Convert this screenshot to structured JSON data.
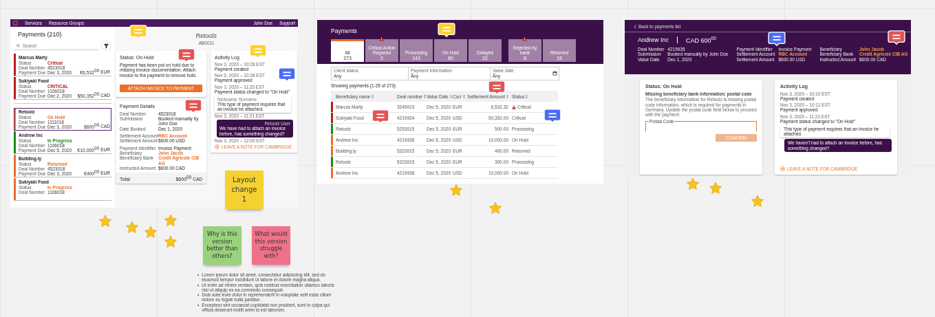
{
  "frame_list_view": {
    "top_bar": {
      "menus": [
        {
          "label": "Services"
        },
        {
          "label": "Resource Groups"
        }
      ],
      "user_menus": [
        {
          "label": "John Doe"
        },
        {
          "label": "Support"
        }
      ]
    },
    "list": {
      "title": "Payments (210)",
      "search_placeholder": "Search",
      "items": [
        {
          "name": "Marcus Marty",
          "color": "#b71c1c",
          "selected": false,
          "rows": [
            {
              "label": "Status",
              "value": "Critical"
            },
            {
              "label": "Deal Number",
              "value": "4523018"
            },
            {
              "label": "Payment Due",
              "value": "Dec 3, 2020"
            }
          ],
          "amount": "€6,532",
          "decimals": "00",
          "currency": "EUR"
        },
        {
          "name": "Sukiyaki Food",
          "color": "#b71c1c",
          "selected": false,
          "rows": [
            {
              "label": "Status",
              "value": "CRITICAL"
            },
            {
              "label": "Deal Number",
              "value": "1106018"
            },
            {
              "label": "Payment Due",
              "value": "Dec 2, 2020"
            }
          ],
          "amount": "$50,352",
          "decimals": "00",
          "currency": "CAD"
        },
        {
          "name": "Retoolz",
          "color": "#e8702a",
          "selected": true,
          "rows": [
            {
              "label": "Status",
              "value": "On Hold"
            },
            {
              "label": "Deal Number",
              "value": "1111018"
            },
            {
              "label": "Payment Due",
              "value": "Dec 3, 2020"
            }
          ],
          "amount": "$600",
          "decimals": "00",
          "currency": "CAD"
        },
        {
          "name": "Andrew Inc",
          "color": "#178a17",
          "selected": false,
          "rows": [
            {
              "label": "Status",
              "value": "In Progress"
            },
            {
              "label": "Deal Number",
              "value": "1106018"
            },
            {
              "label": "Payment Due",
              "value": "Dec 5, 2020"
            }
          ],
          "amount": "€10,000",
          "decimals": "00",
          "currency": "EUR"
        },
        {
          "name": "Building.ly",
          "color": "#e8702a",
          "selected": false,
          "rows": [
            {
              "label": "Status",
              "value": "Returned"
            },
            {
              "label": "Deal Number",
              "value": "4523018"
            },
            {
              "label": "Payment Due",
              "value": "Dec 3, 2020"
            }
          ],
          "amount": "€400",
          "decimals": "00",
          "currency": "EUR"
        },
        {
          "name": "Sukiyaki Food",
          "color": "#e8702a",
          "selected": false,
          "rows": [
            {
              "label": "Status",
              "value": "In Progress"
            },
            {
              "label": "Deal Number",
              "value": "1106018"
            }
          ]
        }
      ]
    },
    "detail": {
      "title": "Retoolz",
      "subtitle": "AB0011",
      "status_card": {
        "title": "Status: On Hold",
        "text": "Payment has been put on hold due to missing invoice documentation. Attach invoice to the payment to remove hold.",
        "button": "ATTACH INVOICE TO PAYMENT"
      },
      "details_card": {
        "title": "Payment Details",
        "groups": [
          [
            {
              "label": "Deal Number",
              "value": "4523018",
              "highlight": false
            },
            {
              "label": "Submission",
              "value": "Booked manually by John Doe",
              "highlight": false
            },
            {
              "label": "Date Booked",
              "value": "Dec 1, 2020",
              "highlight": false
            }
          ],
          [
            {
              "label": "Settlement Account",
              "value": "RBC Account",
              "highlight": true
            },
            {
              "label": "Settlement Amount",
              "value": "$600.00 USD",
              "highlight": false
            }
          ],
          [
            {
              "label": "Payment Identifier",
              "value": "Invoice Payment",
              "highlight": false
            },
            {
              "label": "Beneficiary",
              "value": "John Jacob",
              "highlight": true
            },
            {
              "label": "Beneficiary Bank",
              "value": "Credit Agricole CIB AG",
              "highlight": true
            },
            {
              "label": "Instructed Amount",
              "value": "$600.00 CAD",
              "highlight": false
            }
          ]
        ],
        "total_label": "Total",
        "total_amount": "$600",
        "total_decimals": "00",
        "total_currency": "CAD"
      },
      "activity": {
        "title": "Activity Log",
        "entries": [
          {
            "kind": "event",
            "time": "Nov 3, 2020 – 10:28 EST",
            "text": "Payment created"
          },
          {
            "kind": "event",
            "time": "Nov 3, 2020 – 10:38 EST",
            "text": "Payment approved"
          },
          {
            "kind": "event",
            "time": "Nov 3, 2020 – 11:20 EST",
            "text": "Payment status changed to \"On Hold\""
          },
          {
            "kind": "reply",
            "author": "Nickname Surname",
            "text": "This type of payment requires that an invoice be attached.",
            "time": "Nov 3, 2020 – 11:21 EST"
          },
          {
            "kind": "own",
            "author": "Retoolz User",
            "text": "We have had to attach an invoice before, has something changed?",
            "time": "Nov 3, 2020 – 12:00 EST"
          }
        ],
        "link": "LEAVE A NOTE FOR CAMBRIDGE"
      }
    }
  },
  "frame_table_view": {
    "title": "Payments",
    "tabs": [
      {
        "label": "All",
        "count": "273",
        "selected": true,
        "warning": false
      },
      {
        "label": "Critical Action Required",
        "count": "2",
        "selected": false,
        "warning": true
      },
      {
        "label": "Processing",
        "count": "143",
        "selected": false,
        "warning": false
      },
      {
        "label": "On Hold",
        "count": "80",
        "selected": false,
        "warning": false
      },
      {
        "label": "Delayed",
        "count": "22",
        "selected": false,
        "warning": false
      },
      {
        "label": "Rejected by bank",
        "count": "8",
        "selected": false,
        "warning": true
      },
      {
        "label": "Returned",
        "count": "18",
        "selected": false,
        "warning": false
      }
    ],
    "filters": [
      {
        "label": "Client status",
        "value": "Any"
      },
      {
        "label": "Payment Information",
        "value": "Any"
      },
      {
        "label": "Value date",
        "value": "Any"
      }
    ],
    "showing": "Showing payments (1-25 of 273)",
    "columns": [
      "Beneficiary name",
      "Deal number",
      "Value Date",
      "Curr",
      "Settlement Amount",
      "Status"
    ],
    "rows": [
      {
        "color": "#b71c1c",
        "warning": true,
        "cells": [
          "Marcus Marty",
          "3249015",
          "Dec 5, 2020",
          "EUR",
          "6,532.32",
          "Critical"
        ]
      },
      {
        "color": "#b71c1c",
        "warning": false,
        "cells": [
          "Sukiyaki Food",
          "4219934",
          "Dec 5, 2020",
          "USD",
          "50,352.00",
          "Critical"
        ]
      },
      {
        "color": "#178a17",
        "warning": false,
        "cells": [
          "Retoolz",
          "5253015",
          "Dec 5, 2020",
          "EUR",
          "500.00",
          "Processing"
        ]
      },
      {
        "color": "#e8702a",
        "warning": false,
        "cells": [
          "Andrew Inc",
          "4219935",
          "Dec 5, 2020",
          "USD",
          "10,000.00",
          "On Hold"
        ]
      },
      {
        "color": "#e8702a",
        "warning": false,
        "cells": [
          "Building.ly",
          "5323015",
          "Dec 5, 2020",
          "EUR",
          "400.00",
          "Returned"
        ]
      },
      {
        "color": "#178a17",
        "warning": false,
        "cells": [
          "Retoolz",
          "5323015",
          "Dec 5, 2020",
          "EUR",
          "300.00",
          "Processing"
        ]
      },
      {
        "color": "#e8702a",
        "warning": false,
        "cells": [
          "Andrew Inc",
          "4219938",
          "Dec 5, 2020",
          "USD",
          "10,000.00",
          "On Hold"
        ]
      }
    ]
  },
  "frame_detail_view": {
    "back_link": "Back to payments list",
    "title": "Andrew Inc",
    "amount": "CAD 600",
    "decimals": "00",
    "detail_columns": [
      [
        {
          "label": "Deal Number",
          "value": "4219935",
          "highlight": false
        },
        {
          "label": "Submission",
          "value": "Booked manually by John Doe",
          "highlight": false
        },
        {
          "label": "Value Date",
          "value": "Dec 1, 2020",
          "highlight": false
        }
      ],
      [
        {
          "label": "Payment Identifier",
          "value": "Invoice Payment",
          "highlight": false
        },
        {
          "label": "Settlement Account",
          "value": "RBC Account",
          "highlight": true
        },
        {
          "label": "Settlement Amount",
          "value": "$600.00 USD",
          "highlight": false
        }
      ],
      [
        {
          "label": "Beneficiary",
          "value": "John Jacob",
          "highlight": true
        },
        {
          "label": "Beneficiary Bank",
          "value": "Credit Agricole CIB AG",
          "highlight": true
        },
        {
          "label": "Instructed Amount",
          "value": "$600.00 CAD",
          "highlight": false
        }
      ]
    ],
    "status_card": {
      "title": "Status: On Hold",
      "heading": "Missing beneficiary bank information: postal code",
      "text": "The beneficiary information for Retoolz is missing postal code information, which is required for payments in Germany. Update the postal code field below to proceed with the payment.",
      "field_label": "Postal Code",
      "button": "CONFIRM",
      "button_disabled": true
    },
    "activity": {
      "title": "Activity Log",
      "entries": [
        {
          "kind": "event",
          "time": "Nov 3, 2020 – 10:10 EST",
          "text": "Payment created"
        },
        {
          "kind": "event",
          "time": "Nov 3, 2020 – 10:12 EST",
          "text": "Payment approved"
        },
        {
          "kind": "event",
          "time": "Nov 3, 2020 – 11:21 EST",
          "text": "Payment status changed to \"On Hold\""
        },
        {
          "kind": "reply",
          "text": "This type of payment requires that an invoice be attached."
        },
        {
          "kind": "own",
          "text": "We haven't had to attach an invoice before, has something changed?"
        }
      ],
      "link": "LEAVE A NOTE FOR CAMBRIDGE"
    }
  },
  "sticky_notes": [
    {
      "text": "Layout change 1",
      "color": "#f5d130"
    },
    {
      "text": "Why is this version better than others?",
      "color": "#9ad17c"
    },
    {
      "text": "What would this version struggle with?",
      "color": "#f0728a"
    }
  ],
  "notes_text": [
    {
      "marker": "•",
      "text": "Lorem ipsum dolor sit amet, consectetur adipiscing elit, sed do eiusmod tempor incididunt ut labore et dolore magna aliqua."
    },
    {
      "marker": "•",
      "text": "Ut enim ad minim veniam, quis nostrud exercitation ullamco laboris nisi ut aliquip ex ea commodo consequat."
    },
    {
      "marker": "•",
      "text": "Duis aute irure dolor in reprehenderit in voluptate velit esse cillum dolore eu fugiat nulla pariatur."
    },
    {
      "marker": "•",
      "text": "Excepteur sint occaecat cupidatat non proident, sunt in culpa qui officia deserunt mollit anim id est laborum."
    }
  ],
  "comments": [
    {
      "color": "#ffd02f"
    },
    {
      "color": "#e25555"
    },
    {
      "color": "#ffd02f"
    },
    {
      "color": "#4a6cf7"
    },
    {
      "color": "#e25555"
    },
    {
      "color": "#ffd02f"
    },
    {
      "color": "#e25555"
    },
    {
      "color": "#e25555"
    },
    {
      "color": "#4a6cf7"
    },
    {
      "color": "#4a6cf7"
    },
    {
      "color": "#e25555"
    }
  ]
}
